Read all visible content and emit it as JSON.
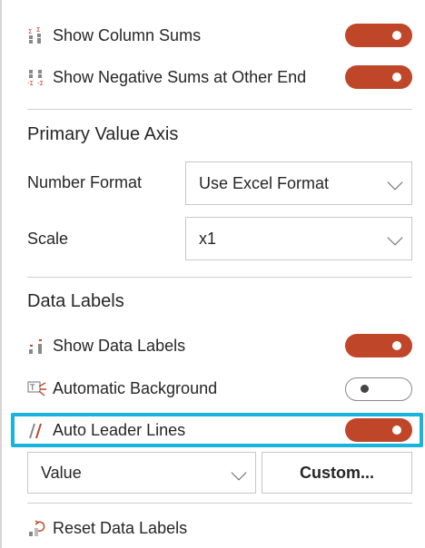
{
  "rows": {
    "show_column_sums": {
      "label": "Show Column Sums",
      "icon": "column-sums-icon",
      "state": "on"
    },
    "show_negative_sums": {
      "label": "Show Negative Sums at Other End",
      "icon": "negative-sums-icon",
      "state": "on"
    },
    "show_data_labels": {
      "label": "Show Data Labels",
      "icon": "data-labels-icon",
      "state": "on"
    },
    "automatic_background": {
      "label": "Automatic Background",
      "icon": "automatic-background-icon",
      "state": "off"
    },
    "auto_leader_lines": {
      "label": "Auto Leader Lines",
      "icon": "leader-lines-icon",
      "state": "on"
    },
    "reset_data_labels": {
      "label": "Reset Data Labels",
      "icon": "reset-icon"
    }
  },
  "primary_value_axis": {
    "title": "Primary Value Axis",
    "number_format": {
      "label": "Number Format",
      "value": "Use Excel Format"
    },
    "scale": {
      "label": "Scale",
      "value": "x1"
    }
  },
  "data_labels": {
    "title": "Data Labels",
    "content_select": {
      "value": "Value"
    },
    "custom_button": "Custom..."
  },
  "colors": {
    "toggle_on": "#c0462a",
    "highlight": "#19b4dc"
  }
}
